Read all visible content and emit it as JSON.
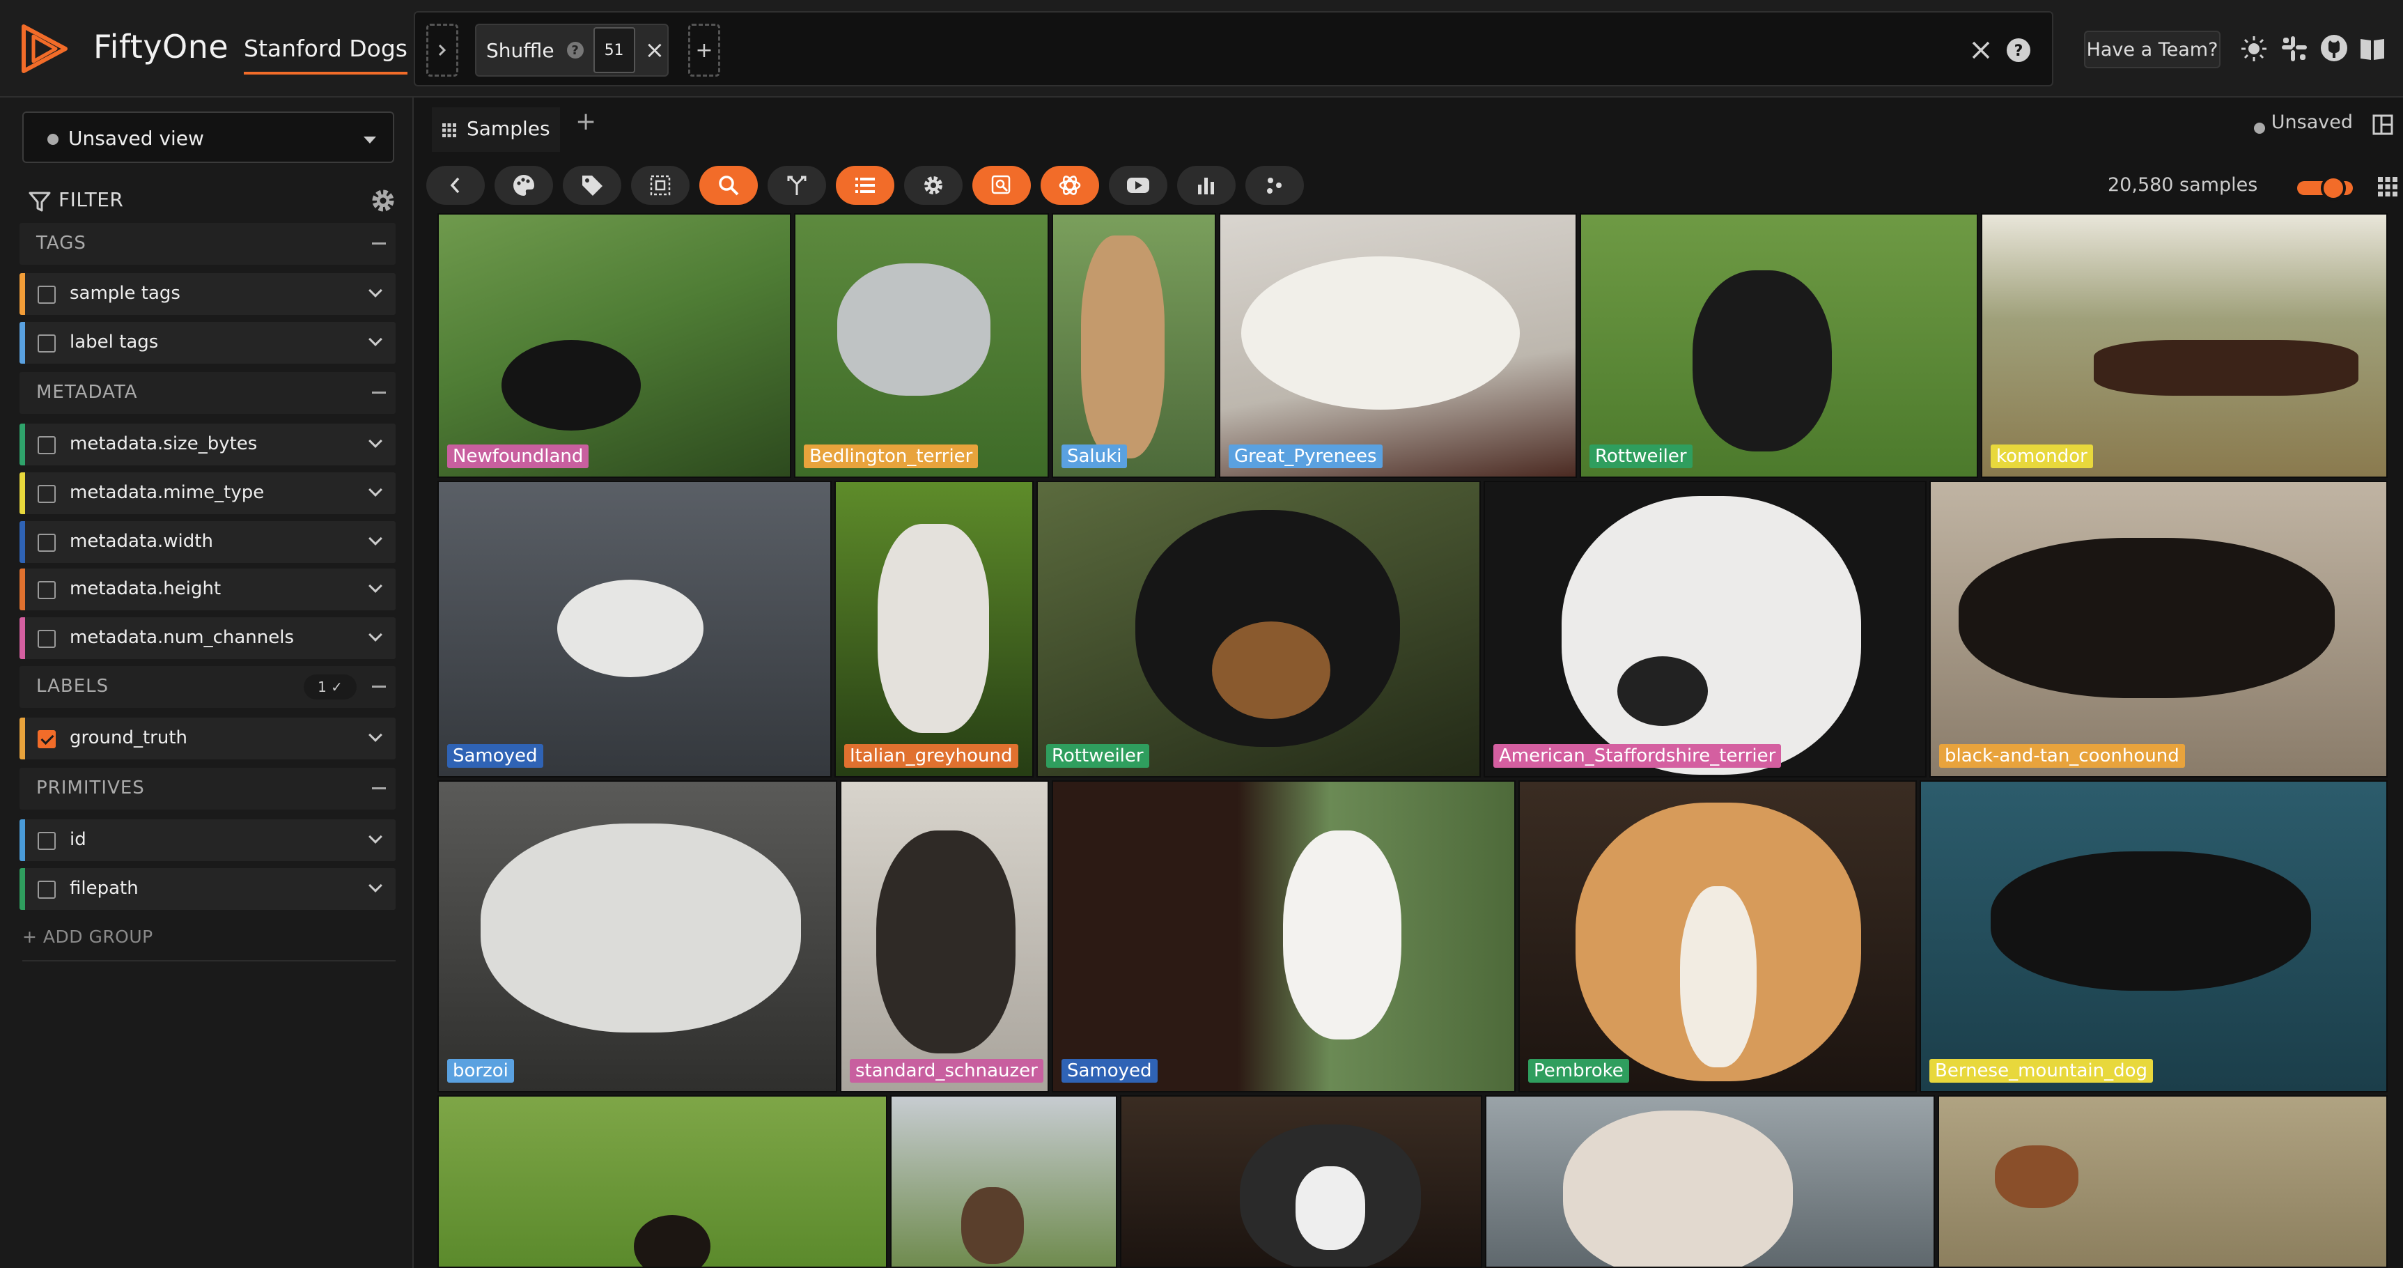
{
  "app": {
    "name": "FiftyOne",
    "dataset": "Stanford Dogs"
  },
  "colors": {
    "accent": "#f26c29"
  },
  "header": {
    "stage": {
      "name": "Shuffle",
      "value": "51"
    },
    "team_button": "Have a Team?",
    "icons": [
      "close-icon",
      "help-icon",
      "theme-icon",
      "slack-icon",
      "github-icon",
      "docs-icon"
    ]
  },
  "sidebar": {
    "view": {
      "label": "Unsaved view"
    },
    "filter_title": "FILTER",
    "groups": [
      {
        "title": "TAGS",
        "fields": [
          {
            "name": "sample tags",
            "color": "#f29d38",
            "checked": false
          },
          {
            "name": "label tags",
            "color": "#5aa1e0",
            "checked": false
          }
        ]
      },
      {
        "title": "METADATA",
        "fields": [
          {
            "name": "metadata.size_bytes",
            "color": "#2fa36b",
            "checked": false
          },
          {
            "name": "metadata.mime_type",
            "color": "#e8d83c",
            "checked": false
          },
          {
            "name": "metadata.width",
            "color": "#2f63b5",
            "checked": false
          },
          {
            "name": "metadata.height",
            "color": "#e0712f",
            "checked": false
          },
          {
            "name": "metadata.num_channels",
            "color": "#d45fa0",
            "checked": false
          }
        ]
      },
      {
        "title": "LABELS",
        "badge": "1 ✓",
        "fields": [
          {
            "name": "ground_truth",
            "color": "#e8a33c",
            "checked": true
          }
        ]
      },
      {
        "title": "PRIMITIVES",
        "fields": [
          {
            "name": "id",
            "color": "#4a9bd8",
            "checked": false
          },
          {
            "name": "filepath",
            "color": "#2f9e5e",
            "checked": false
          }
        ]
      }
    ],
    "add_group": "+ ADD GROUP"
  },
  "main": {
    "tab_label": "Samples",
    "tab_add": "+",
    "unsaved": "Unsaved",
    "sample_count": "20,580 samples",
    "tiles": [
      {
        "label": "Newfoundland",
        "color": "#c85f9f"
      },
      {
        "label": "Bedlington_terrier",
        "color": "#e8a33c"
      },
      {
        "label": "Saluki",
        "color": "#5aa1e0"
      },
      {
        "label": "Great_Pyrenees",
        "color": "#5aa1e0"
      },
      {
        "label": "Rottweiler",
        "color": "#2f9e5e"
      },
      {
        "label": "komondor",
        "color": "#e8d83c"
      },
      {
        "label": "Samoyed",
        "color": "#2f63b5"
      },
      {
        "label": "Italian_greyhound",
        "color": "#e0712f"
      },
      {
        "label": "Rottweiler",
        "color": "#2f9e5e"
      },
      {
        "label": "American_Staffordshire_terrier",
        "color": "#d45fa0"
      },
      {
        "label": "black-and-tan_coonhound",
        "color": "#e8a33c"
      },
      {
        "label": "borzoi",
        "color": "#5aa1e0"
      },
      {
        "label": "standard_schnauzer",
        "color": "#c85f9f"
      },
      {
        "label": "Samoyed",
        "color": "#2f63b5"
      },
      {
        "label": "Pembroke",
        "color": "#2f9e5e"
      },
      {
        "label": "Bernese_mountain_dog",
        "color": "#e8d83c"
      },
      {
        "label": "",
        "color": "#444"
      },
      {
        "label": "",
        "color": "#444"
      },
      {
        "label": "",
        "color": "#444"
      },
      {
        "label": "",
        "color": "#444"
      },
      {
        "label": "",
        "color": "#444"
      }
    ]
  }
}
